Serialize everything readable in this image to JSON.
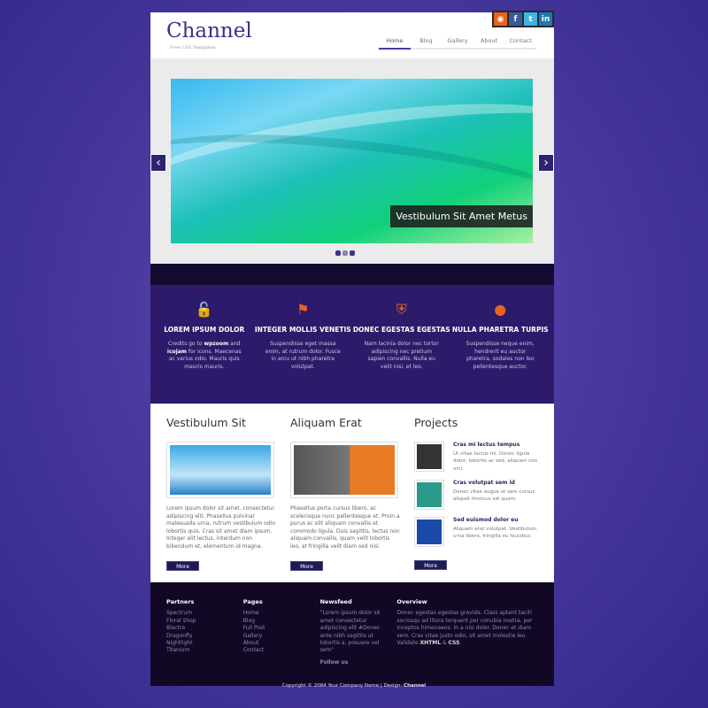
{
  "header": {
    "logo": "Channel",
    "tagline": "Free CSS Templates",
    "social": [
      {
        "icon": "rss-icon",
        "glyph": "◉",
        "color": "#e8641c"
      },
      {
        "icon": "facebook-icon",
        "glyph": "f",
        "color": "#3b5998"
      },
      {
        "icon": "twitter-icon",
        "glyph": "t",
        "color": "#3cb4e8"
      },
      {
        "icon": "linkedin-icon",
        "glyph": "in",
        "color": "#1a7ab8"
      }
    ],
    "nav": [
      "Home",
      "Blog",
      "Gallery",
      "About",
      "Contact"
    ],
    "active_nav": "Home"
  },
  "slider": {
    "caption": "Vestibulum Sit Amet Metus",
    "prev": "‹",
    "next": "›",
    "slides": 3,
    "current": 2
  },
  "features": [
    {
      "icon": "lock-icon",
      "glyph": "🔓",
      "title": "LOREM IPSUM DOLOR",
      "text_pre": "Credits go to ",
      "b1": "wpzoom",
      "mid": " and ",
      "b2": "icojam",
      "text_post": " for icons. Maecenas ac varius odio. Mauris quis mauris mauris."
    },
    {
      "icon": "flag-icon",
      "glyph": "⚑",
      "title": "INTEGER MOLLIS VENETIS",
      "text": "Suspendisse eget massa enim, at rutrum dolor. Fusce in arcu ut nibh pharetra volutpat."
    },
    {
      "icon": "shield-icon",
      "glyph": "⛨",
      "title": "DONEC EGESTAS EGESTAS",
      "text": "Nam lacinia dolor nec tortor adipiscing nec pretium sapien convallis. Nulla eu velit nisi, et leo."
    },
    {
      "icon": "bug-icon",
      "glyph": "●",
      "title": "NULLA PHARETRA TURPIS",
      "text": "Suspendisse neque enim, hendrerit eu auctor pharetra, sodales non leo pellentesque auctor."
    }
  ],
  "content": {
    "col1": {
      "title": "Vestibulum Sit",
      "text": "Lorem ipsum dolor sit amet, consectetur adipiscing elit. Phasellus pulvinar malesuada urna, rutrum vestibulum odio lobortis quis. Cras sit amet diam ipsum. Integer elit lectus, interdum non bibendum et, elementum id magna.",
      "more": "More"
    },
    "col2": {
      "title": "Aliquam Erat",
      "text": "Phasellus porta cursus libero, ac scelerisque nunc pellentesque et. Proin a purus ac elit aliquam convallis et commodo ligula. Duis sagittis, lectus non aliquam convallis, quam velit lobortis leo, at fringilla velit diam sed nisi.",
      "more": "More"
    },
    "projects": {
      "title": "Projects",
      "more": "More",
      "items": [
        {
          "title": "Cras mi lectus tempus",
          "text": "Ut vitae luctus mi. Donec ligula dolor, lobortis ac sed, aliquam non orci."
        },
        {
          "title": "Cras volutpat sem id",
          "text": "Donec vitae augue ut sem cursus aliquet rhoncus vel quam."
        },
        {
          "title": "Sed euismod dolor eu",
          "text": "Aliquam erat volutpat. Vestibulum urna libero, fringilla eu faucibus ."
        }
      ]
    }
  },
  "footer": {
    "partners": {
      "title": "Partners",
      "items": [
        "Spectrum",
        "Floral Shop",
        "Blactro",
        "Dragonfly",
        "Nightlight",
        "Titanium"
      ]
    },
    "pages": {
      "title": "Pages",
      "items": [
        "Home",
        "Blog",
        "Full Post",
        "Gallery",
        "About",
        "Contact"
      ]
    },
    "newsfeed": {
      "title": "Newsfeed",
      "text": "\"Lorem ipsum dolor sit amet consectetur adipiscing elit #Donec ante nibh sagittis ut lobortis a, posuere vel sem\"",
      "follow": "Follow us"
    },
    "overview": {
      "title": "Overview",
      "text": "Donec egestas egestas gravida. Class aptent taciti sociosqu ad litora torquent per conubia nostra, per inceptos himenaeos. In a nisi dolor. Donec et diam sem. Cras vitae justo odio, sit amet molestie leo. Validate ",
      "xhtml": "XHTML",
      "amp": " & ",
      "css": "CSS",
      "end": "."
    }
  },
  "copyright": {
    "text": "Copyright © 2084 Your Company Name | Design: ",
    "brand": "Channel"
  }
}
